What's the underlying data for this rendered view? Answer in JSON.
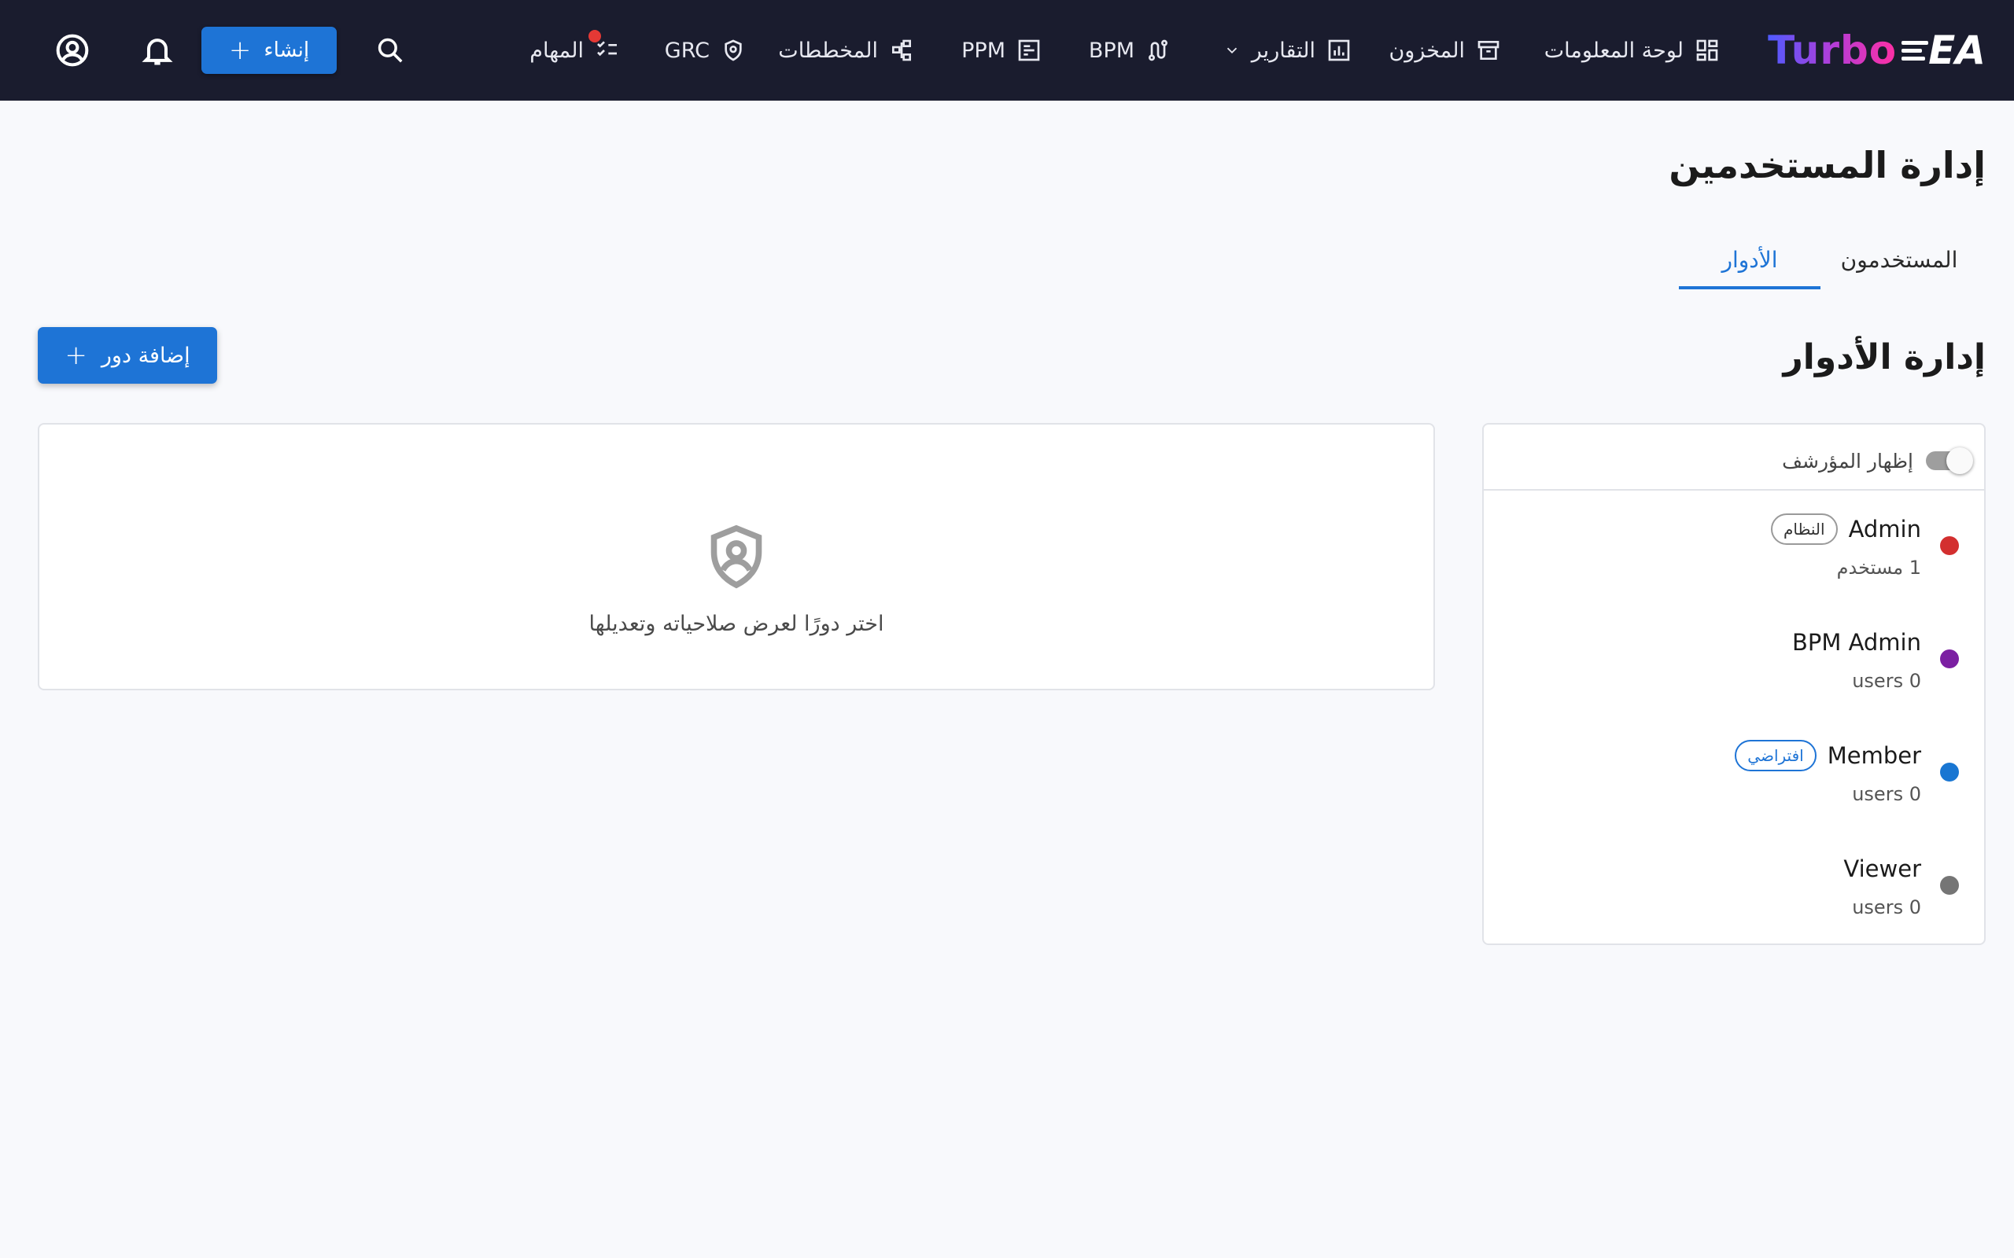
{
  "app": {
    "logo_text": "Turbo",
    "logo_suffix": "EA"
  },
  "nav": {
    "items": [
      {
        "key": "dashboard",
        "label": "لوحة المعلومات",
        "icon": "dashboard-icon"
      },
      {
        "key": "inventory",
        "label": "المخزون",
        "icon": "archive-icon"
      },
      {
        "key": "reports",
        "label": "التقارير",
        "icon": "bar-chart-icon",
        "has_dropdown": true
      },
      {
        "key": "bpm",
        "label": "BPM",
        "icon": "route-icon"
      },
      {
        "key": "ppm",
        "label": "PPM",
        "icon": "project-icon"
      },
      {
        "key": "diagrams",
        "label": "المخططات",
        "icon": "diagram-icon"
      },
      {
        "key": "grc",
        "label": "GRC",
        "icon": "shield-check-icon"
      },
      {
        "key": "tasks",
        "label": "المهام",
        "icon": "checklist-icon",
        "has_notification": true
      }
    ],
    "create_label": "إنشاء"
  },
  "page": {
    "title": "إدارة المستخدمين",
    "tabs": [
      {
        "label": "المستخدمون",
        "active": false
      },
      {
        "label": "الأدوار",
        "active": true
      }
    ]
  },
  "roles_section": {
    "title": "إدارة الأدوار",
    "add_button_label": "إضافة دور",
    "show_archived_label": "إظهار المؤرشف",
    "show_archived": false,
    "roles": [
      {
        "name": "Admin",
        "badge": "النظام",
        "badge_type": "system",
        "users": "1 مستخدم",
        "color": "#d32f2f"
      },
      {
        "name": "BPM Admin",
        "badge": "",
        "badge_type": "",
        "users": "0 users",
        "color": "#7b1fa2"
      },
      {
        "name": "Member",
        "badge": "افتراضي",
        "badge_type": "default",
        "users": "0 users",
        "color": "#1976d2"
      },
      {
        "name": "Viewer",
        "badge": "",
        "badge_type": "",
        "users": "0 users",
        "color": "#757575"
      }
    ],
    "empty_detail_text": "اختر دورًا لعرض صلاحياته وتعديلها"
  },
  "colors": {
    "topbar": "#1a1c2e",
    "accent": "#1e74d6",
    "page_bg": "#f8f9fc"
  }
}
